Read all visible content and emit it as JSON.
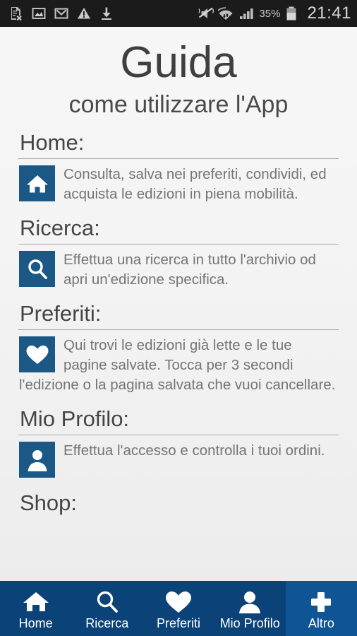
{
  "status_bar": {
    "left_icons": [
      {
        "name": "document-error-icon",
        "label": "document-x"
      },
      {
        "name": "photo-icon",
        "label": "image"
      },
      {
        "name": "gmail-icon",
        "label": "mail"
      },
      {
        "name": "warning-icon",
        "label": "warning"
      },
      {
        "name": "download-icon",
        "label": "download"
      }
    ],
    "right_icons": [
      {
        "name": "vibrate-mute-icon",
        "label": "silent-vibrate"
      },
      {
        "name": "wifi-icon",
        "label": "wifi"
      },
      {
        "name": "signal-bars-icon",
        "label": "signal"
      }
    ],
    "battery_percent": "35%",
    "battery_icon": "battery-icon",
    "clock": "21:41"
  },
  "header": {
    "title": "Guida",
    "subtitle": "come utilizzare l'App"
  },
  "sections": [
    {
      "heading": "Home:",
      "icon": "home-icon",
      "text": "Consulta, salva nei preferiti, condividi, ed acquista le edizioni in piena mobilità."
    },
    {
      "heading": "Ricerca:",
      "icon": "search-icon",
      "text": "Effettua una ricerca in tutto l'archivio od apri un'edizione specifica."
    },
    {
      "heading": "Preferiti:",
      "icon": "heart-icon",
      "text": "Qui trovi le edizioni già lette e le tue pagine salvate. Tocca per 3 secondi l'edizione o la pagina salvata che vuoi cancellare."
    },
    {
      "heading": "Mio Profilo:",
      "icon": "person-icon",
      "text": "Effettua l'accesso e controlla i tuoi ordini."
    },
    {
      "heading": "Shop:",
      "icon": "cart-icon",
      "text": ""
    }
  ],
  "navbar": {
    "items": [
      {
        "label": "Home",
        "icon": "home-icon",
        "active": false
      },
      {
        "label": "Ricerca",
        "icon": "search-icon",
        "active": false
      },
      {
        "label": "Preferiti",
        "icon": "heart-icon",
        "active": false
      },
      {
        "label": "Mio Profilo",
        "icon": "person-icon",
        "active": false
      },
      {
        "label": "Altro",
        "icon": "plus-icon",
        "active": true
      }
    ]
  },
  "colors": {
    "navbar_bg": "#0b4378",
    "navbar_active_bg": "#0f5596",
    "icon_tile_bg": "#1b5886",
    "page_bg": "#f3f3f3",
    "status_bar_bg": "#1b1b1b",
    "heading_text": "#454545",
    "body_text": "#757575"
  }
}
